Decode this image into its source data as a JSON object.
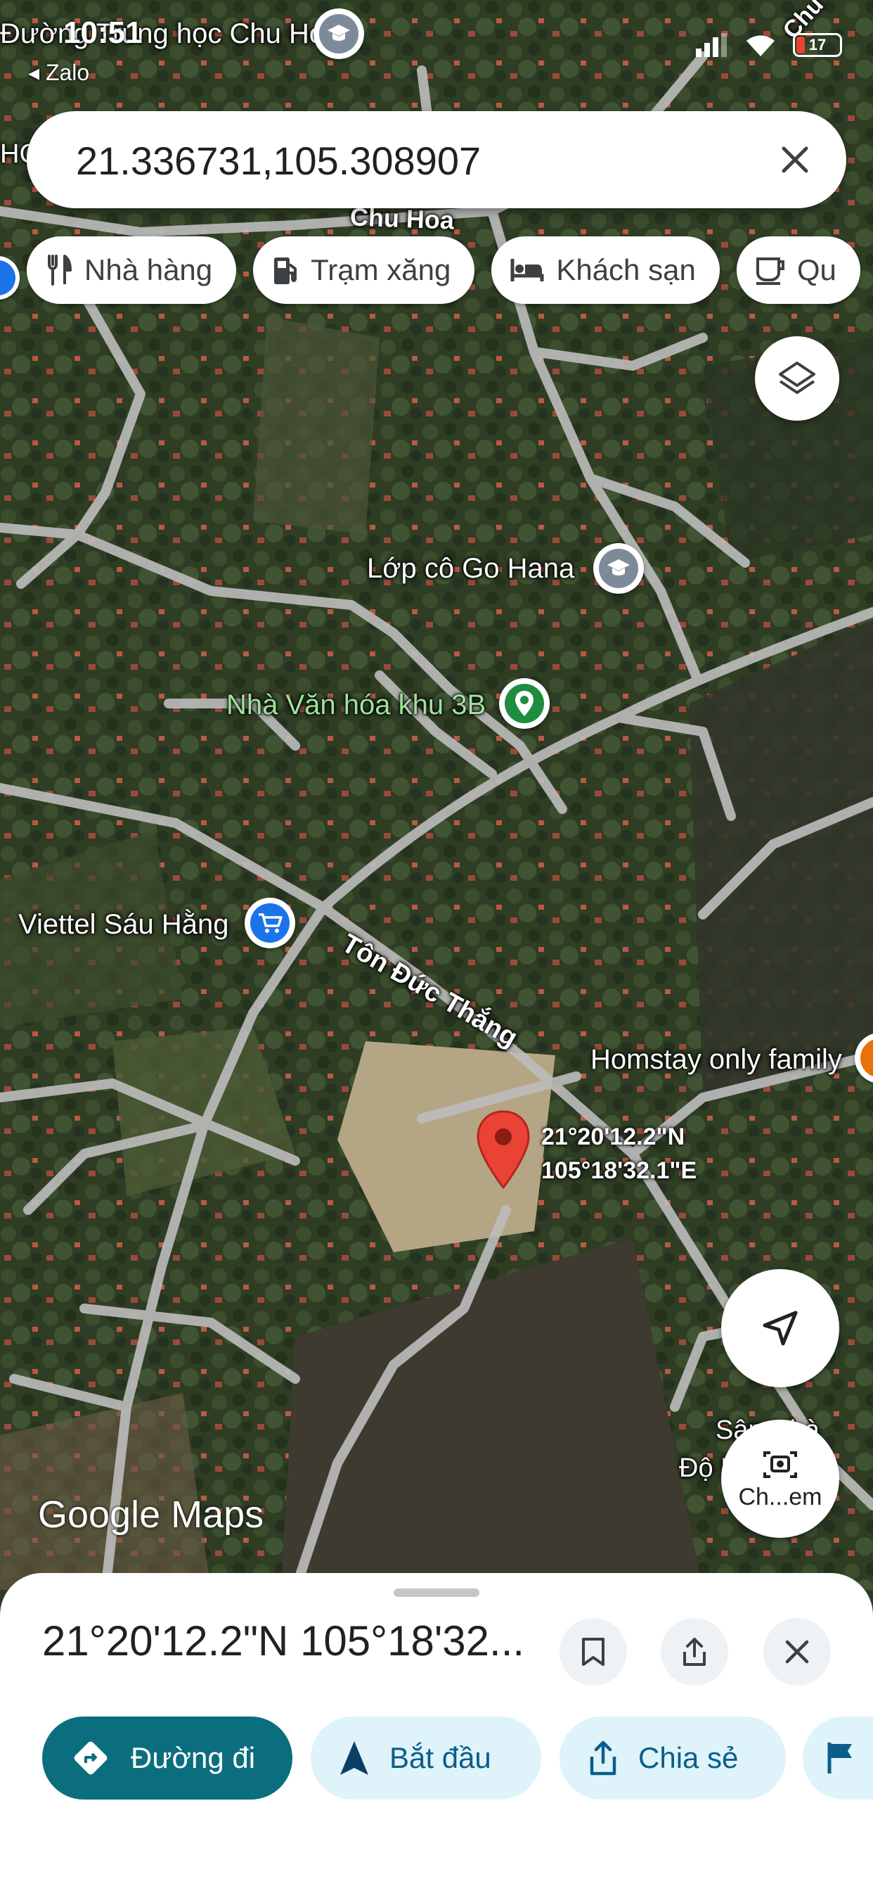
{
  "status_bar": {
    "time": "10:51",
    "back_app": "Zalo",
    "battery": "17"
  },
  "search": {
    "value": "21.336731,105.308907"
  },
  "chips": [
    {
      "icon": "restaurant-icon",
      "label": "Nhà hàng"
    },
    {
      "icon": "gas-station-icon",
      "label": "Trạm xăng"
    },
    {
      "icon": "hotel-icon",
      "label": "Khách sạn"
    },
    {
      "icon": "coffee-icon",
      "label": "Qu"
    }
  ],
  "map": {
    "labels": {
      "top_school": "Đường Trung học Chu Hóa",
      "road_chu_hoa": "Chu Hoa",
      "road_top_right": "Chu",
      "school_go_hana": "Lớp cô Go Hana",
      "culture_house": "Nhà Văn hóa khu 3B",
      "viettel": "Viettel Sáu Hằng",
      "road_ton_duc_thang": "Tôn Đức Thắng",
      "homestay": "Homstay only family",
      "stadium_partial": "Sân Nhà",
      "stadium_partial2": "Độ Phu",
      "left_edge": "HC"
    },
    "pin_label_lat": "21°20'12.2\"N",
    "pin_label_lng": "105°18'32.1\"E",
    "watermark": "Google Maps",
    "camera_label": "Ch...em"
  },
  "sheet": {
    "coords_title": "21°20'12.2\"N 105°18'32...",
    "actions": {
      "directions": "Đường đi",
      "start": "Bắt đầu",
      "share": "Chia sẻ"
    }
  },
  "colors": {
    "primary": "#0b6e7e",
    "secondary_bg": "#dff3fa",
    "pin": "#d93025",
    "shop_blue": "#1a73e8",
    "park_green": "#1e8e3e"
  }
}
